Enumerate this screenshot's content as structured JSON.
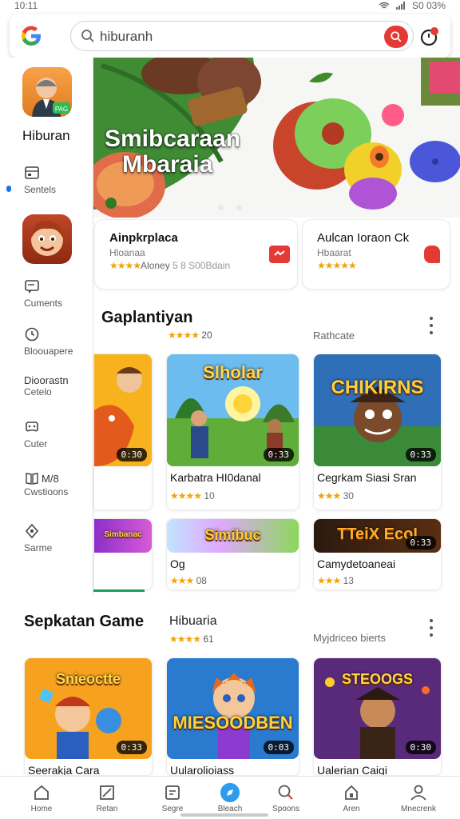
{
  "status_bar": {
    "time": "10:11",
    "right": "S0 03%"
  },
  "search": {
    "query": "hiburanh"
  },
  "sidebar": {
    "featured_label": "Hiburan",
    "items": [
      {
        "label": "Sentels",
        "icon": "calendar-icon"
      },
      {
        "label": "Cuments",
        "icon": "comment-icon"
      },
      {
        "label": "Bloouapere",
        "icon": "clock-icon"
      },
      {
        "label": "Dioorastn",
        "label2": "Cetelo"
      },
      {
        "label": "Cuter",
        "icon": "gamepad-icon"
      },
      {
        "label": "M/8",
        "label2": "Cwstioons",
        "icon": "book-icon"
      },
      {
        "label": "Sarme",
        "icon": "location-icon"
      }
    ]
  },
  "hero": {
    "title_line1": "Smibcaraan",
    "title_line2": "Mbaraia"
  },
  "promos": [
    {
      "title": "Ainpkrplaca",
      "subtitle": "Hloanaa",
      "meta": "Aloney",
      "meta2": "5 8 S00Bdain",
      "stars": "★★★★"
    },
    {
      "title": "Aulcan Ioraon Ck",
      "subtitle": "Hbaarat",
      "stars": "★★★★★"
    }
  ],
  "section1": {
    "title": "Gaplantiyan",
    "rating_stars": "★★★★",
    "rating_value": "20",
    "right_label": "Rathcate",
    "cards": [
      {
        "art_text": "",
        "badge": "0:30",
        "title": "",
        "stars": "",
        "rating": ""
      },
      {
        "art_text": "Slholar",
        "badge": "0:33",
        "title": "Karbatra HI0danal",
        "stars": "★★★★",
        "rating": "10"
      },
      {
        "art_text": "CHIKIRNS",
        "badge": "0:33",
        "title": "Cegrkam Siasi Sran",
        "stars": "★★★",
        "rating": "30"
      }
    ],
    "cards_row2": [
      {
        "art_text": "Simbanac",
        "badge": "",
        "title": "",
        "stars": "",
        "rating": ""
      },
      {
        "art_text": "Simibuc",
        "badge": "",
        "title": "Og",
        "stars": "★★★",
        "rating": "08"
      },
      {
        "art_text": "TTeiX EcoI",
        "badge": "0:33",
        "title": "Camydetoaneai",
        "stars": "★★★",
        "rating": "13"
      }
    ]
  },
  "section2": {
    "title": "Sepkatan Game",
    "subtitle": "Hibuaria",
    "rating_stars": "★★★★",
    "rating_value": "61",
    "right_label": "Myjdriceo bierts",
    "cards": [
      {
        "art_text": "Snieoctte",
        "badge": "0:33",
        "title": "Seerakja Cara"
      },
      {
        "art_text": "MIESOODBEN",
        "badge": "0:03",
        "title": "Uularolioiass"
      },
      {
        "art_text": "STEOOGS",
        "badge": "0:30",
        "title": "Ualerian Caigi"
      }
    ]
  },
  "bottom_nav": [
    {
      "label": "Home",
      "icon": "home-icon"
    },
    {
      "label": "Retan",
      "icon": "edit-icon"
    },
    {
      "label": "Segre",
      "icon": "dashboard-icon"
    },
    {
      "label": "Bleach",
      "icon": "compass-icon",
      "active": true
    },
    {
      "label": "Spoons",
      "icon": "search-icon"
    },
    {
      "label": "Aren",
      "icon": "lock-icon"
    },
    {
      "label": "Mnecrenk",
      "icon": "person-icon"
    }
  ],
  "colors": {
    "accent_red": "#e53935",
    "active_blue": "#2d9cf0",
    "star": "#f4a300",
    "progress_green": "#16a05c"
  }
}
